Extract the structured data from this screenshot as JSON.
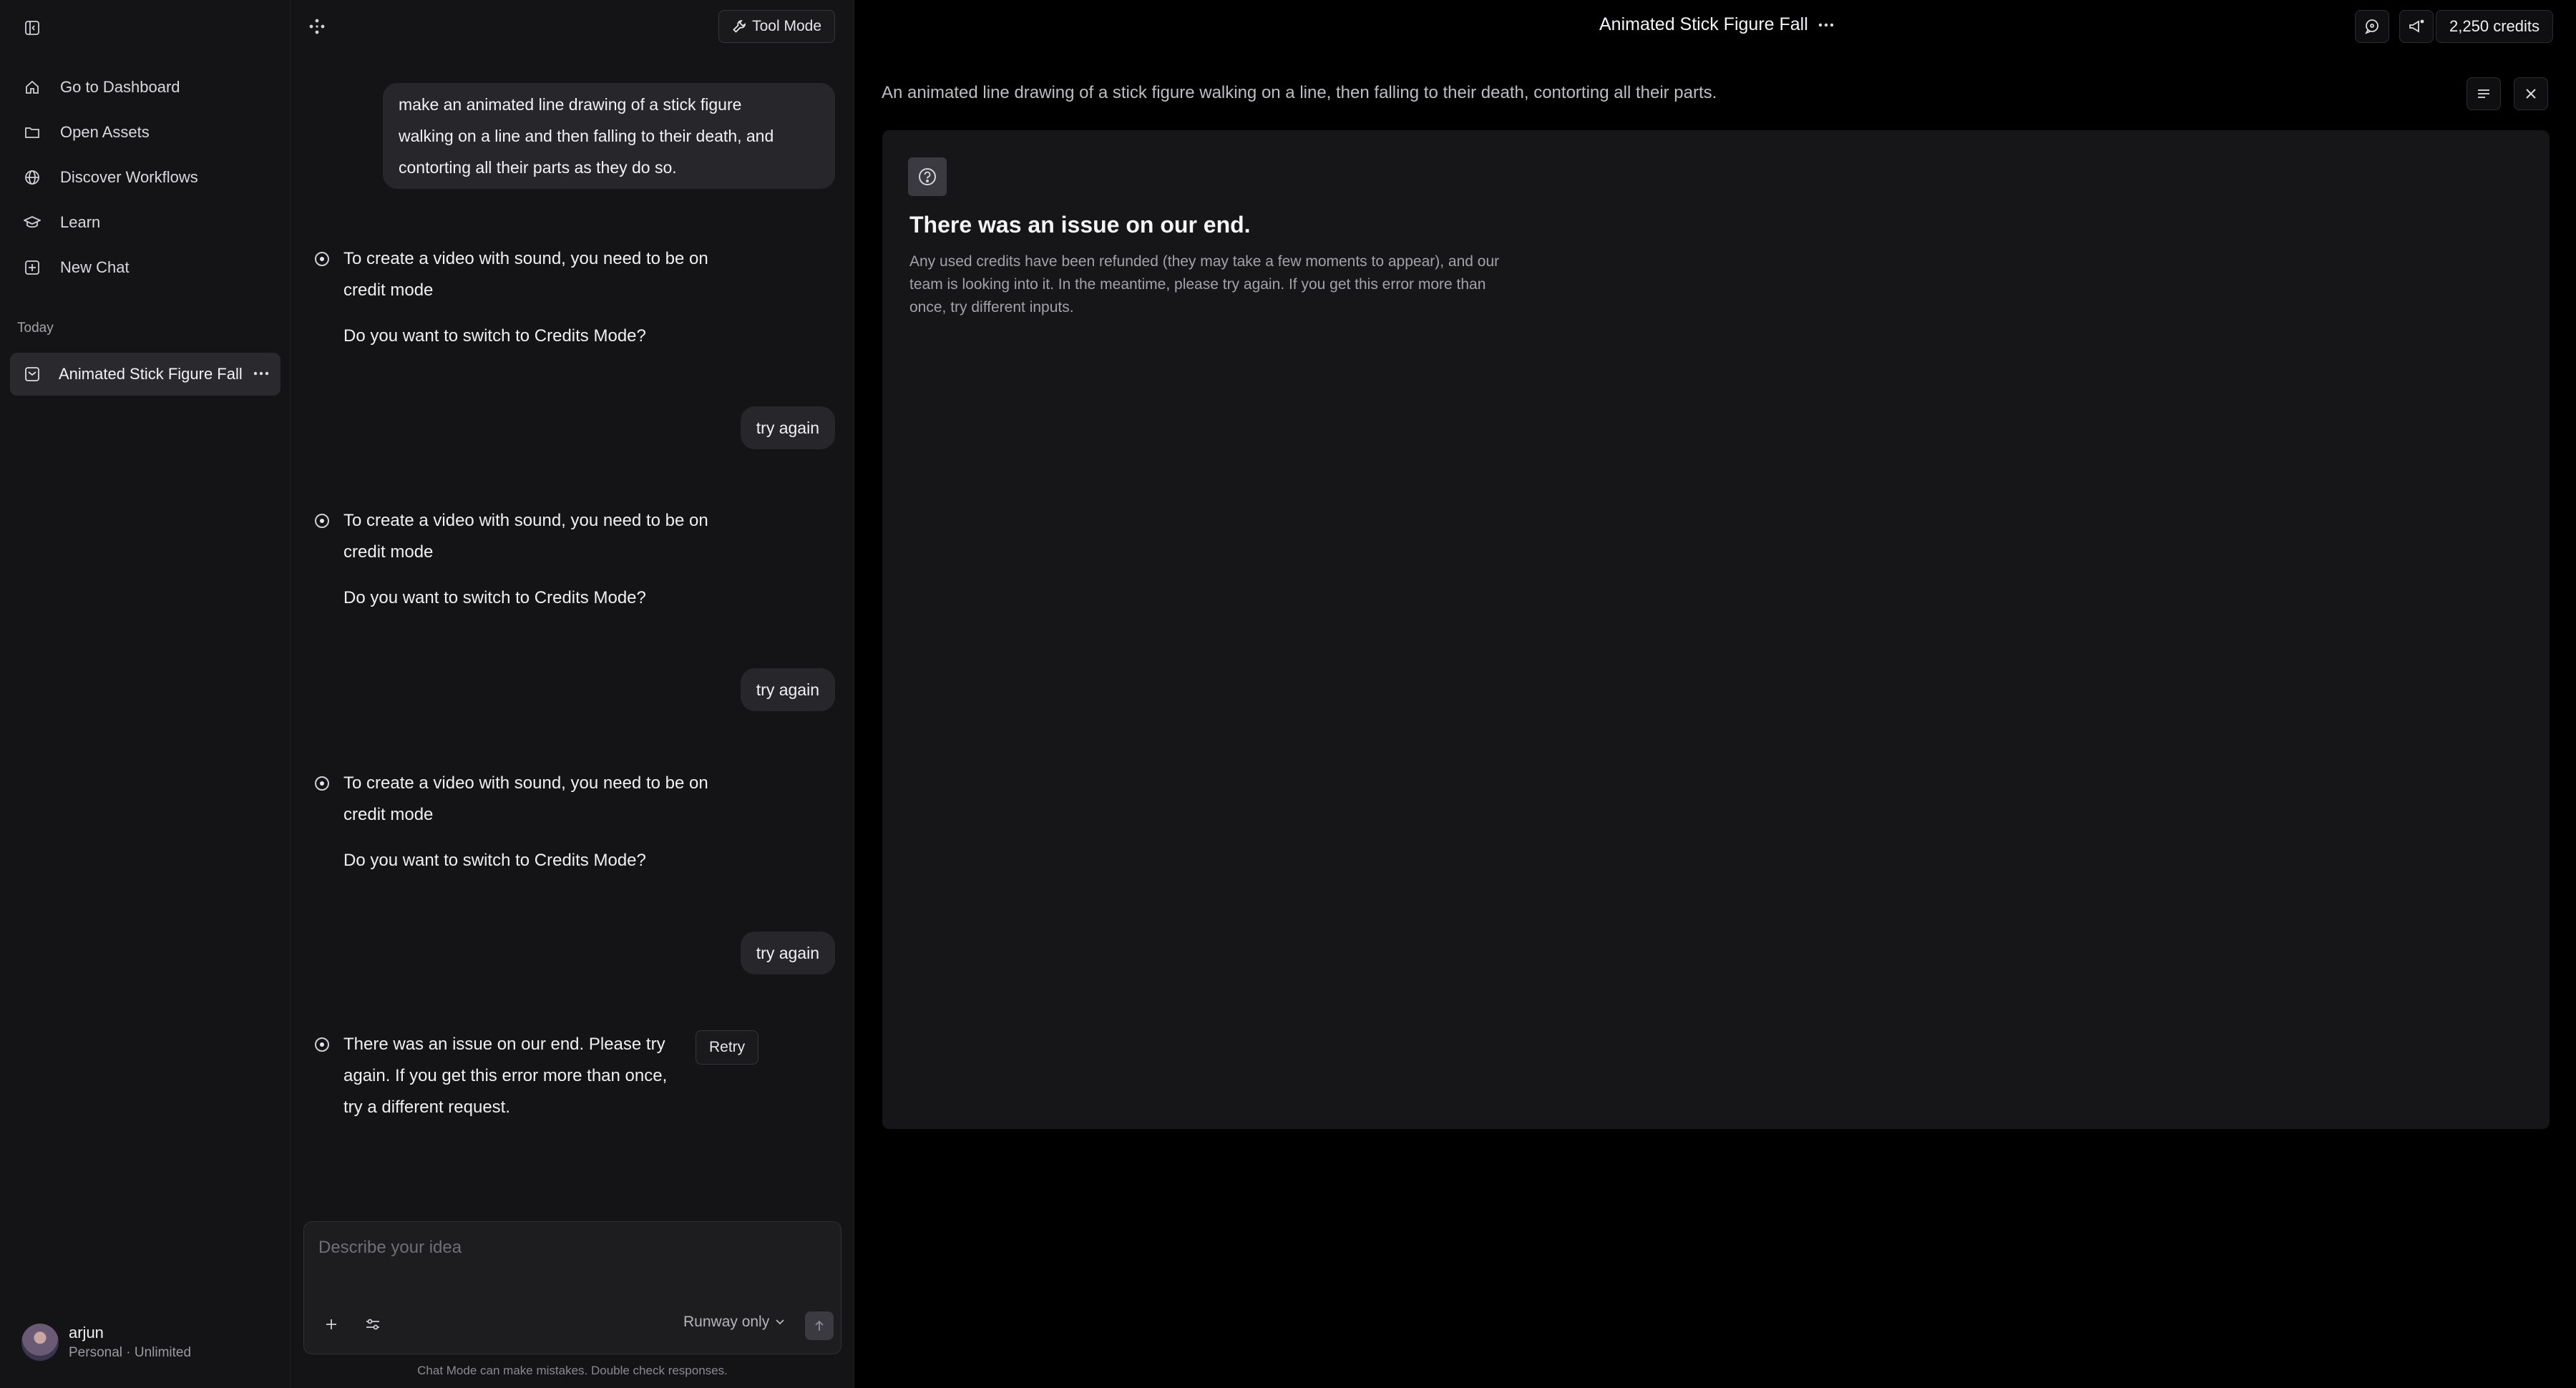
{
  "sidebar": {
    "nav": [
      {
        "label": "Go to Dashboard",
        "icon": "home-icon"
      },
      {
        "label": "Open Assets",
        "icon": "folder-icon"
      },
      {
        "label": "Discover Workflows",
        "icon": "globe-icon"
      },
      {
        "label": "Learn",
        "icon": "graduation-cap-icon"
      },
      {
        "label": "New Chat",
        "icon": "plus-square-icon"
      }
    ],
    "section_label": "Today",
    "chat_items": [
      {
        "label": "Animated Stick Figure Fall",
        "active": true
      }
    ],
    "profile": {
      "name": "arjun",
      "plan": "Personal · Unlimited"
    }
  },
  "chat": {
    "tool_mode_label": "Tool Mode",
    "user_prompt_lines": [
      "make an animated line drawing of a stick figure",
      "walking on a line and then falling to their death, and",
      "contorting all their parts as they do so."
    ],
    "bot_1": {
      "text": "To create a video with sound, you need to be on credit mode",
      "question": "Do you want to switch to Credits Mode?"
    },
    "user_2": "try again",
    "bot_2": {
      "text": "To create a video with sound, you need to be on credit mode",
      "question": "Do you want to switch to Credits Mode?"
    },
    "user_3": "try again",
    "bot_3": {
      "text": "To create a video with sound, you need to be on credit mode",
      "question": "Do you want to switch to Credits Mode?"
    },
    "user_4": "try again",
    "bot_4": {
      "text": "There was an issue on our end. Please try again. If you get this error more than once, try a different request."
    },
    "retry_label": "Retry",
    "composer": {
      "placeholder": "Describe your idea",
      "model_select": "Runway only"
    },
    "disclaimer": "Chat Mode can make mistakes. Double check responses."
  },
  "main": {
    "title": "Animated Stick Figure Fall",
    "credits": "2,250 credits",
    "prompt": "An animated line drawing of a stick figure walking on a line, then falling to their death, contorting all their parts.",
    "error": {
      "title": "There was an issue on our end.",
      "body": "Any used credits have been refunded (they may take a few moments to appear), and our team is looking into it. In the meantime, please try again. If you get this error more than once, try different inputs."
    }
  },
  "colors": {
    "background": "#000000",
    "panel": "#141416",
    "card": "#161618",
    "bubble": "#27272b",
    "text": "#f0f0f2",
    "muted": "#a2a2a8"
  }
}
